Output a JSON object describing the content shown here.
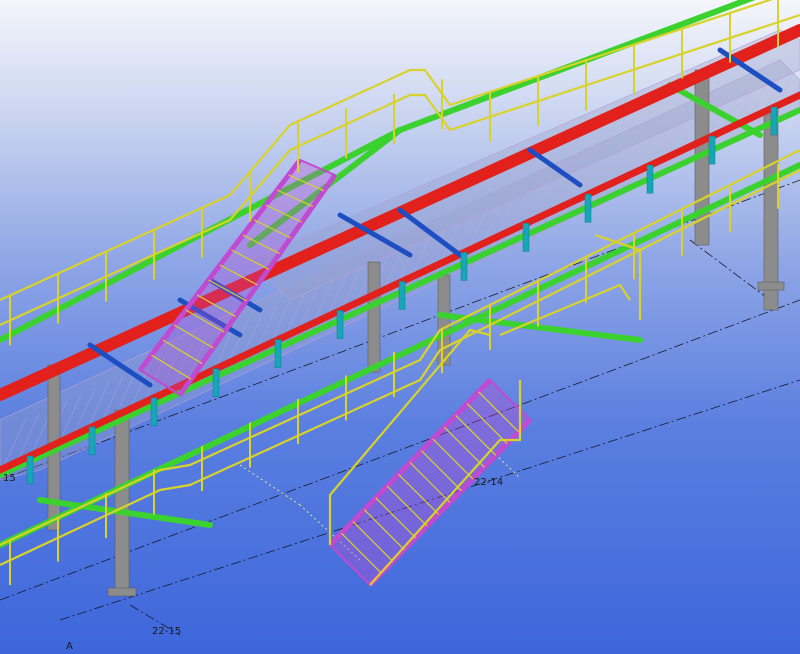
{
  "colors": {
    "handrail": "#d8d22a",
    "main_beam": "#e2211c",
    "secondary_beam": "#3bd12f",
    "column": "#8c8c8c",
    "bracket": "#16a6b8",
    "brace": "#1e4fc2",
    "stair_stringer": "#c04ad1",
    "grating": "#9aa0c8",
    "gridline": "#1a1a2a"
  },
  "grid_labels": {
    "label_22_14": "22-14",
    "label_22_15": "22-15",
    "label_a": "A",
    "label_15": "15"
  }
}
